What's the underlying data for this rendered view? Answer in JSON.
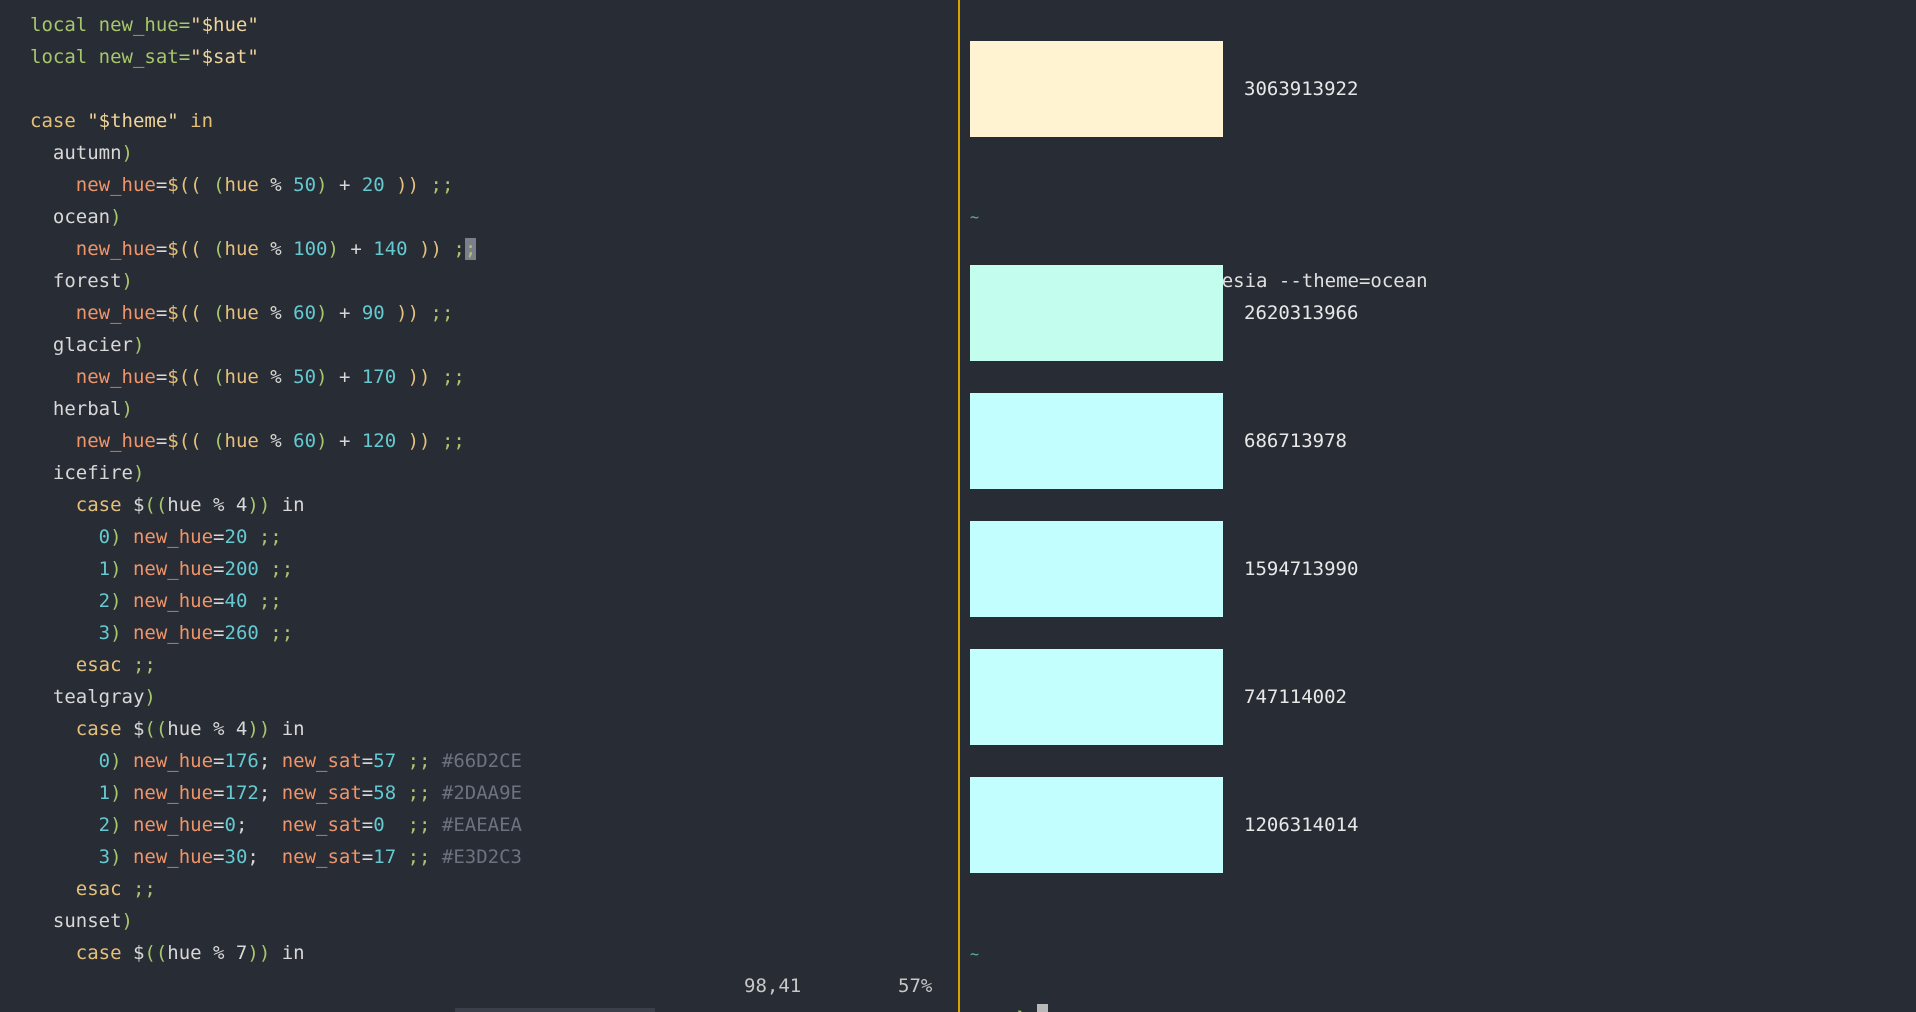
{
  "editor": {
    "lines": [
      [
        {
          "t": "local",
          "c": "kwlocal"
        },
        {
          "t": " new_hue=",
          "c": "kwlocal"
        },
        {
          "t": "\"$hue\"",
          "c": "str"
        }
      ],
      [
        {
          "t": "local",
          "c": "kwlocal"
        },
        {
          "t": " new_sat=",
          "c": "kwlocal"
        },
        {
          "t": "\"$sat\"",
          "c": "str"
        }
      ],
      [],
      [
        {
          "t": "case",
          "c": "kw"
        },
        {
          "t": " ",
          "c": "plain"
        },
        {
          "t": "\"$theme\"",
          "c": "str"
        },
        {
          "t": " in",
          "c": "kw"
        }
      ],
      [
        {
          "t": "  autumn",
          "c": "plain"
        },
        {
          "t": ")",
          "c": "punc"
        }
      ],
      [
        {
          "t": "    new_hue",
          "c": "var"
        },
        {
          "t": "=",
          "c": "plain"
        },
        {
          "t": "$((",
          "c": "kw"
        },
        {
          "t": " (",
          "c": "punc"
        },
        {
          "t": "hue",
          "c": "kw"
        },
        {
          "t": " % ",
          "c": "op"
        },
        {
          "t": "50",
          "c": "num"
        },
        {
          "t": ")",
          "c": "punc"
        },
        {
          "t": " + ",
          "c": "op"
        },
        {
          "t": "20",
          "c": "num"
        },
        {
          "t": " ))",
          "c": "kw"
        },
        {
          "t": " ;;",
          "c": "semi"
        }
      ],
      [
        {
          "t": "  ocean",
          "c": "plain"
        },
        {
          "t": ")",
          "c": "punc"
        }
      ],
      [
        {
          "t": "    new_hue",
          "c": "var"
        },
        {
          "t": "=",
          "c": "plain"
        },
        {
          "t": "$((",
          "c": "kw"
        },
        {
          "t": " (",
          "c": "punc"
        },
        {
          "t": "hue",
          "c": "kw"
        },
        {
          "t": " % ",
          "c": "op"
        },
        {
          "t": "100",
          "c": "num"
        },
        {
          "t": ")",
          "c": "punc"
        },
        {
          "t": " + ",
          "c": "op"
        },
        {
          "t": "140",
          "c": "num"
        },
        {
          "t": " ))",
          "c": "kw"
        },
        {
          "t": " ;",
          "c": "semi"
        },
        {
          "t": ";",
          "c": "semi",
          "cursor": true
        }
      ],
      [
        {
          "t": "  forest",
          "c": "plain"
        },
        {
          "t": ")",
          "c": "punc"
        }
      ],
      [
        {
          "t": "    new_hue",
          "c": "var"
        },
        {
          "t": "=",
          "c": "plain"
        },
        {
          "t": "$((",
          "c": "kw"
        },
        {
          "t": " (",
          "c": "punc"
        },
        {
          "t": "hue",
          "c": "kw"
        },
        {
          "t": " % ",
          "c": "op"
        },
        {
          "t": "60",
          "c": "num"
        },
        {
          "t": ")",
          "c": "punc"
        },
        {
          "t": " + ",
          "c": "op"
        },
        {
          "t": "90",
          "c": "num"
        },
        {
          "t": " ))",
          "c": "kw"
        },
        {
          "t": " ;;",
          "c": "semi"
        }
      ],
      [
        {
          "t": "  glacier",
          "c": "plain"
        },
        {
          "t": ")",
          "c": "punc"
        }
      ],
      [
        {
          "t": "    new_hue",
          "c": "var"
        },
        {
          "t": "=",
          "c": "plain"
        },
        {
          "t": "$((",
          "c": "kw"
        },
        {
          "t": " (",
          "c": "punc"
        },
        {
          "t": "hue",
          "c": "kw"
        },
        {
          "t": " % ",
          "c": "op"
        },
        {
          "t": "50",
          "c": "num"
        },
        {
          "t": ")",
          "c": "punc"
        },
        {
          "t": " + ",
          "c": "op"
        },
        {
          "t": "170",
          "c": "num"
        },
        {
          "t": " ))",
          "c": "kw"
        },
        {
          "t": " ;;",
          "c": "semi"
        }
      ],
      [
        {
          "t": "  herbal",
          "c": "plain"
        },
        {
          "t": ")",
          "c": "punc"
        }
      ],
      [
        {
          "t": "    new_hue",
          "c": "var"
        },
        {
          "t": "=",
          "c": "plain"
        },
        {
          "t": "$((",
          "c": "kw"
        },
        {
          "t": " (",
          "c": "punc"
        },
        {
          "t": "hue",
          "c": "kw"
        },
        {
          "t": " % ",
          "c": "op"
        },
        {
          "t": "60",
          "c": "num"
        },
        {
          "t": ")",
          "c": "punc"
        },
        {
          "t": " + ",
          "c": "op"
        },
        {
          "t": "120",
          "c": "num"
        },
        {
          "t": " ))",
          "c": "kw"
        },
        {
          "t": " ;;",
          "c": "semi"
        }
      ],
      [
        {
          "t": "  icefire",
          "c": "plain"
        },
        {
          "t": ")",
          "c": "punc"
        }
      ],
      [
        {
          "t": "    case",
          "c": "kw"
        },
        {
          "t": " $",
          "c": "plain"
        },
        {
          "t": "((",
          "c": "punc"
        },
        {
          "t": "hue % 4",
          "c": "plain"
        },
        {
          "t": "))",
          "c": "punc"
        },
        {
          "t": " in",
          "c": "plain"
        }
      ],
      [
        {
          "t": "      0",
          "c": "num"
        },
        {
          "t": ")",
          "c": "punc"
        },
        {
          "t": " new_hue",
          "c": "var"
        },
        {
          "t": "=",
          "c": "plain"
        },
        {
          "t": "20",
          "c": "num"
        },
        {
          "t": " ;;",
          "c": "semi"
        }
      ],
      [
        {
          "t": "      1",
          "c": "num"
        },
        {
          "t": ")",
          "c": "punc"
        },
        {
          "t": " new_hue",
          "c": "var"
        },
        {
          "t": "=",
          "c": "plain"
        },
        {
          "t": "200",
          "c": "num"
        },
        {
          "t": " ;;",
          "c": "semi"
        }
      ],
      [
        {
          "t": "      2",
          "c": "num"
        },
        {
          "t": ")",
          "c": "punc"
        },
        {
          "t": " new_hue",
          "c": "var"
        },
        {
          "t": "=",
          "c": "plain"
        },
        {
          "t": "40",
          "c": "num"
        },
        {
          "t": " ;;",
          "c": "semi"
        }
      ],
      [
        {
          "t": "      3",
          "c": "num"
        },
        {
          "t": ")",
          "c": "punc"
        },
        {
          "t": " new_hue",
          "c": "var"
        },
        {
          "t": "=",
          "c": "plain"
        },
        {
          "t": "260",
          "c": "num"
        },
        {
          "t": " ;;",
          "c": "semi"
        }
      ],
      [
        {
          "t": "    esac",
          "c": "kw"
        },
        {
          "t": " ;;",
          "c": "semi"
        }
      ],
      [
        {
          "t": "  tealgray",
          "c": "plain"
        },
        {
          "t": ")",
          "c": "punc"
        }
      ],
      [
        {
          "t": "    case",
          "c": "kw"
        },
        {
          "t": " $",
          "c": "plain"
        },
        {
          "t": "((",
          "c": "punc"
        },
        {
          "t": "hue % 4",
          "c": "plain"
        },
        {
          "t": "))",
          "c": "punc"
        },
        {
          "t": " in",
          "c": "plain"
        }
      ],
      [
        {
          "t": "      0",
          "c": "num"
        },
        {
          "t": ")",
          "c": "punc"
        },
        {
          "t": " new_hue",
          "c": "var"
        },
        {
          "t": "=",
          "c": "plain"
        },
        {
          "t": "176",
          "c": "num"
        },
        {
          "t": ";",
          "c": "plain"
        },
        {
          "t": " new_sat",
          "c": "var"
        },
        {
          "t": "=",
          "c": "plain"
        },
        {
          "t": "57",
          "c": "num"
        },
        {
          "t": " ;;",
          "c": "semi"
        },
        {
          "t": " #66D2CE",
          "c": "muted"
        }
      ],
      [
        {
          "t": "      1",
          "c": "num"
        },
        {
          "t": ")",
          "c": "punc"
        },
        {
          "t": " new_hue",
          "c": "var"
        },
        {
          "t": "=",
          "c": "plain"
        },
        {
          "t": "172",
          "c": "num"
        },
        {
          "t": ";",
          "c": "plain"
        },
        {
          "t": " new_sat",
          "c": "var"
        },
        {
          "t": "=",
          "c": "plain"
        },
        {
          "t": "58",
          "c": "num"
        },
        {
          "t": " ;;",
          "c": "semi"
        },
        {
          "t": " #2DAA9E",
          "c": "muted"
        }
      ],
      [
        {
          "t": "      2",
          "c": "num"
        },
        {
          "t": ")",
          "c": "punc"
        },
        {
          "t": " new_hue",
          "c": "var"
        },
        {
          "t": "=",
          "c": "plain"
        },
        {
          "t": "0",
          "c": "num"
        },
        {
          "t": ";  ",
          "c": "plain"
        },
        {
          "t": " new_sat",
          "c": "var"
        },
        {
          "t": "=",
          "c": "plain"
        },
        {
          "t": "0",
          "c": "num"
        },
        {
          "t": "  ;;",
          "c": "semi"
        },
        {
          "t": " #EAEAEA",
          "c": "muted"
        }
      ],
      [
        {
          "t": "      3",
          "c": "num"
        },
        {
          "t": ")",
          "c": "punc"
        },
        {
          "t": " new_hue",
          "c": "var"
        },
        {
          "t": "=",
          "c": "plain"
        },
        {
          "t": "30",
          "c": "num"
        },
        {
          "t": "; ",
          "c": "plain"
        },
        {
          "t": " new_sat",
          "c": "var"
        },
        {
          "t": "=",
          "c": "plain"
        },
        {
          "t": "17",
          "c": "num"
        },
        {
          "t": " ;;",
          "c": "semi"
        },
        {
          "t": " #E3D2C3",
          "c": "muted"
        }
      ],
      [
        {
          "t": "    esac",
          "c": "kw"
        },
        {
          "t": " ;;",
          "c": "semi"
        }
      ],
      [
        {
          "t": "  sunset",
          "c": "plain"
        },
        {
          "t": ")",
          "c": "punc"
        }
      ],
      [
        {
          "t": "    case",
          "c": "kw"
        },
        {
          "t": " $",
          "c": "plain"
        },
        {
          "t": "((",
          "c": "punc"
        },
        {
          "t": "hue % 7",
          "c": "plain"
        },
        {
          "t": "))",
          "c": "punc"
        },
        {
          "t": " in",
          "c": "plain"
        }
      ]
    ],
    "status": {
      "position": "98,41",
      "percent": "57%"
    }
  },
  "terminal": {
    "first_swatch": {
      "color": "#fff3d2",
      "value": "3063913922"
    },
    "tilde_1": "~",
    "command": {
      "arrow": "❯",
      "text": "repeat 5 sinesthesia --theme=ocean"
    },
    "swatches": [
      {
        "color": "#c2fdee",
        "value": "2620313966"
      },
      {
        "color": "#c2fefd",
        "value": "686713978"
      },
      {
        "color": "#c2fefe",
        "value": "1594713990"
      },
      {
        "color": "#c2fffd",
        "value": "747114002"
      },
      {
        "color": "#c2fefe",
        "value": "1206314014"
      }
    ],
    "tilde_2": "~",
    "prompt_arrow": "❯"
  },
  "colors": {
    "background": "#282c34",
    "divider": "#d8a300",
    "keyword": "#e5c07b",
    "variable": "#f0956a",
    "number": "#66c8d0",
    "punctuation": "#a8c66c"
  }
}
